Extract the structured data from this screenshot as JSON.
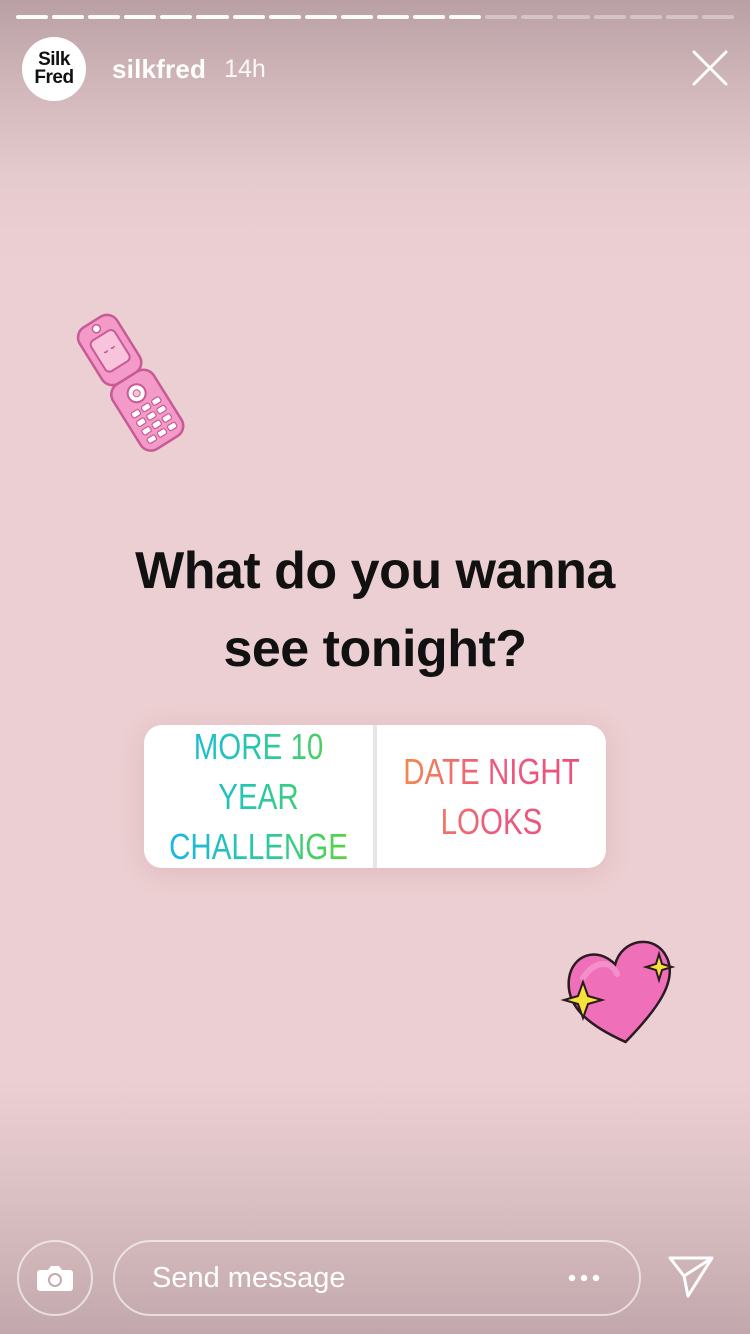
{
  "story": {
    "segments_total": 20,
    "segments_completed": 13,
    "account": {
      "avatar_line1": "Silk",
      "avatar_line2": "Fred",
      "username": "silkfred",
      "time_ago": "14h"
    }
  },
  "content": {
    "question_line1": "What do you wanna",
    "question_line2": "see tonight?",
    "poll": {
      "option_a_line1": "MORE 10 YEAR",
      "option_a_line2": "CHALLENGE",
      "option_b_line1": "DATE NIGHT",
      "option_b_line2": "LOOKS"
    },
    "stickers": [
      "flip-phone-sticker",
      "heart-sparkles-sticker"
    ]
  },
  "footer": {
    "message_placeholder": "Send message"
  },
  "icons": {
    "close": "close-icon",
    "camera": "camera-icon",
    "more": "more-dots-icon",
    "send": "paper-plane-icon"
  },
  "colors": {
    "background": "#ECD0D2",
    "option_a_gradient": [
      "#1BB5E8",
      "#5BD43B"
    ],
    "option_b_gradient": [
      "#F28B4B",
      "#E9507A"
    ]
  }
}
